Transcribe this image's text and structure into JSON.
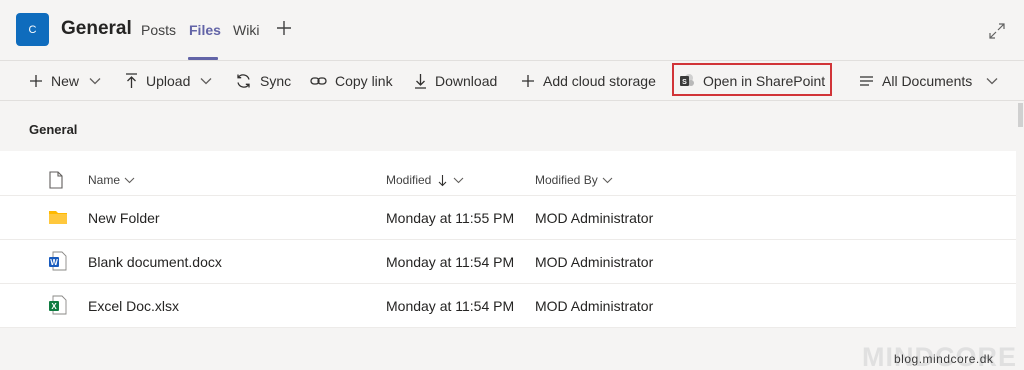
{
  "team": {
    "avatar_letter": "C",
    "avatar_color": "#0f6cbd"
  },
  "channel": {
    "title": "General"
  },
  "tabs": [
    {
      "label": "Posts",
      "active": false
    },
    {
      "label": "Files",
      "active": true
    },
    {
      "label": "Wiki",
      "active": false
    }
  ],
  "toolbar": {
    "new_label": "New",
    "upload_label": "Upload",
    "sync_label": "Sync",
    "copy_link_label": "Copy link",
    "download_label": "Download",
    "add_cloud_storage_label": "Add cloud storage",
    "open_sharepoint_label": "Open in SharePoint",
    "view_label": "All Documents"
  },
  "breadcrumb": "General",
  "columns": {
    "name": "Name",
    "modified": "Modified",
    "modified_by": "Modified By"
  },
  "files": [
    {
      "name": "New Folder",
      "modified": "Monday at 11:55 PM",
      "modified_by": "MOD Administrator",
      "icon": "folder-icon"
    },
    {
      "name": "Blank document.docx",
      "modified": "Monday at 11:54 PM",
      "modified_by": "MOD Administrator",
      "icon": "word-doc-icon"
    },
    {
      "name": "Excel Doc.xlsx",
      "modified": "Monday at 11:54 PM",
      "modified_by": "MOD Administrator",
      "icon": "excel-doc-icon"
    }
  ],
  "watermark": {
    "large": "MINDCORE",
    "small": "blog.mindcore.dk"
  },
  "colors": {
    "accent": "#6264a7",
    "highlight": "#d13438",
    "folder": "#ffb900",
    "word": "#185abd",
    "excel": "#107c41"
  }
}
